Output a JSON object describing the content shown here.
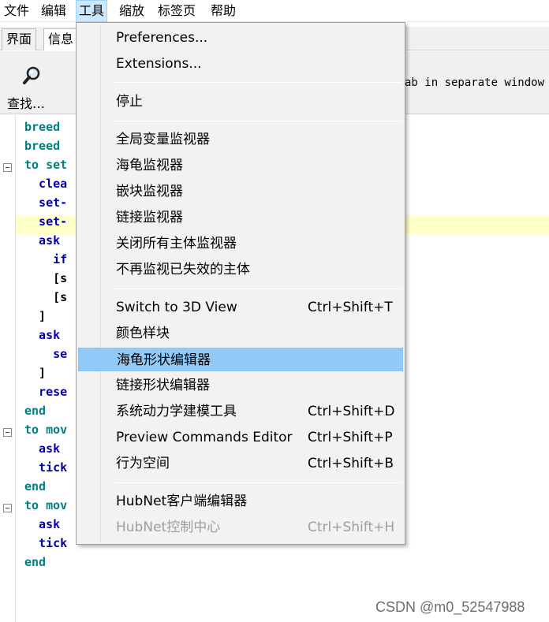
{
  "menubar": {
    "items": [
      "文件",
      "编辑",
      "工具",
      "缩放",
      "标签页",
      "帮助"
    ]
  },
  "tabs": [
    "界面",
    "信息"
  ],
  "toolbar": {
    "find_label": "查找…",
    "separate_window_text": "ab in separate window"
  },
  "editor": {
    "lines": [
      {
        "text": "breed",
        "color": "green"
      },
      {
        "text": "breed",
        "color": "green"
      },
      {
        "text": "to set",
        "color": "green"
      },
      {
        "text": "  clea",
        "color": "blue"
      },
      {
        "text": "  set-",
        "color": "blue"
      },
      {
        "text": "  set-",
        "color": "blue"
      },
      {
        "text": "  ask",
        "color": "blue"
      },
      {
        "text": "    if",
        "color": "blue"
      },
      {
        "text": "    [s",
        "color": "black"
      },
      {
        "text": "    [s",
        "color": "black"
      },
      {
        "text": "  ]",
        "color": "black"
      },
      {
        "text": "  ask",
        "color": "blue"
      },
      {
        "text": "    se",
        "color": "blue"
      },
      {
        "text": "  ]",
        "color": "black"
      },
      {
        "text": "  rese",
        "color": "blue"
      },
      {
        "text": "end",
        "color": "green"
      },
      {
        "text": "to mov",
        "color": "green"
      },
      {
        "text": "  ask",
        "color": "blue"
      },
      {
        "text": "  tick",
        "color": "blue"
      },
      {
        "text": "end",
        "color": "green"
      },
      {
        "text": "to mov",
        "color": "green"
      },
      {
        "text": "  ask",
        "color": "blue"
      },
      {
        "text": "  tick",
        "color": "blue"
      },
      {
        "text": "end",
        "color": "green"
      }
    ]
  },
  "tools_menu": {
    "items": [
      {
        "label": "Preferences...",
        "shortcut": ""
      },
      {
        "label": "Extensions...",
        "shortcut": ""
      },
      {
        "label": "停止",
        "shortcut": ""
      },
      {
        "label": "全局变量监视器",
        "shortcut": ""
      },
      {
        "label": "海龟监视器",
        "shortcut": ""
      },
      {
        "label": "嵌块监视器",
        "shortcut": ""
      },
      {
        "label": "链接监视器",
        "shortcut": ""
      },
      {
        "label": "关闭所有主体监视器",
        "shortcut": ""
      },
      {
        "label": "不再监视已失效的主体",
        "shortcut": ""
      },
      {
        "label": "Switch to 3D View",
        "shortcut": "Ctrl+Shift+T"
      },
      {
        "label": "颜色样块",
        "shortcut": ""
      },
      {
        "label": "海龟形状编辑器",
        "shortcut": ""
      },
      {
        "label": "链接形状编辑器",
        "shortcut": ""
      },
      {
        "label": "系统动力学建模工具",
        "shortcut": "Ctrl+Shift+D"
      },
      {
        "label": "Preview Commands Editor",
        "shortcut": "Ctrl+Shift+P"
      },
      {
        "label": "行为空间",
        "shortcut": "Ctrl+Shift+B"
      },
      {
        "label": "HubNet客户端编辑器",
        "shortcut": ""
      },
      {
        "label": "HubNet控制中心",
        "shortcut": "Ctrl+Shift+H"
      }
    ]
  },
  "watermark": "CSDN @m0_52547988"
}
